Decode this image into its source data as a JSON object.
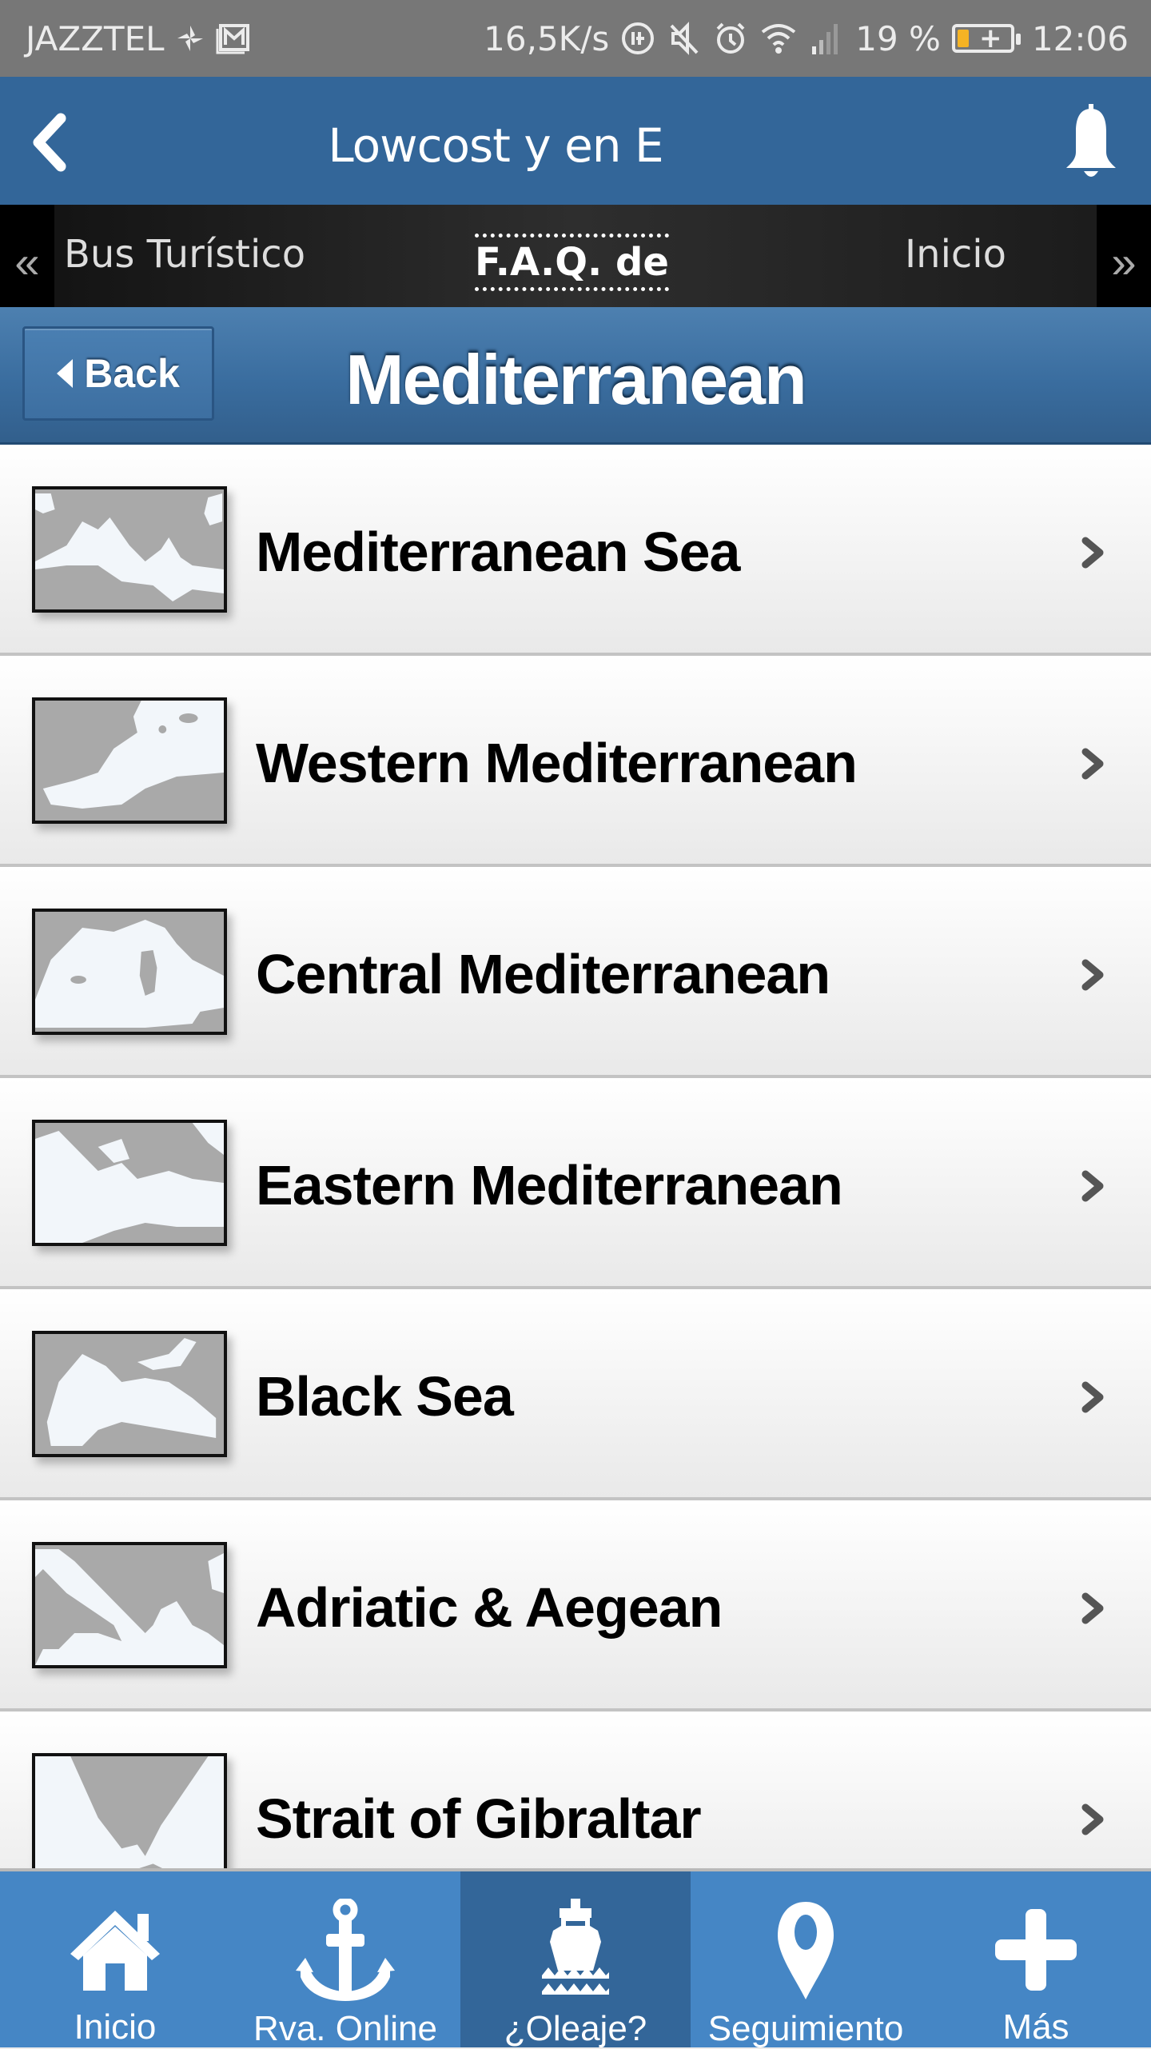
{
  "status_bar": {
    "carrier": "JAZZTEL",
    "net_speed": "16,5K/s",
    "battery_percent": "19 %",
    "battery_level": 0.19,
    "battery_color": "#f5b324",
    "time": "12:06",
    "icons": [
      "sync-icon",
      "gmail-icon",
      "data-saver-icon",
      "mute-icon",
      "alarm-icon",
      "wifi-icon",
      "signal-icon",
      "battery-charging-icon"
    ]
  },
  "header": {
    "title": "Lowcost y en E",
    "back_icon": "chevron-left-icon",
    "bell_icon": "bell-icon",
    "bg_color": "#336699"
  },
  "tabs": {
    "prev_icon": "double-chevron-left-icon",
    "next_icon": "double-chevron-right-icon",
    "items": [
      {
        "label": "Bus Turístico",
        "active": false
      },
      {
        "label": "F.A.Q. de",
        "active": true
      },
      {
        "label": "Inicio",
        "active": false
      }
    ]
  },
  "sub_header": {
    "back_label": "Back",
    "title": "Mediterranean"
  },
  "list": {
    "items": [
      {
        "label": "Mediterranean Sea",
        "thumb": "map-mediterranean-sea"
      },
      {
        "label": "Western Mediterranean",
        "thumb": "map-western-mediterranean"
      },
      {
        "label": "Central Mediterranean",
        "thumb": "map-central-mediterranean"
      },
      {
        "label": "Eastern Mediterranean",
        "thumb": "map-eastern-mediterranean"
      },
      {
        "label": "Black Sea",
        "thumb": "map-black-sea"
      },
      {
        "label": "Adriatic & Aegean",
        "thumb": "map-adriatic-aegean"
      },
      {
        "label": "Strait of Gibraltar",
        "thumb": "map-strait-of-gibraltar"
      }
    ]
  },
  "bottom_nav": {
    "active_color": "#336699",
    "bg_color": "#4586c5",
    "items": [
      {
        "label": "Inicio",
        "icon": "home-icon",
        "active": false
      },
      {
        "label": "Rva. Online",
        "icon": "anchor-icon",
        "active": false
      },
      {
        "label": "¿Oleaje?",
        "icon": "ship-waves-icon",
        "active": true
      },
      {
        "label": "Seguimiento",
        "icon": "map-pin-icon",
        "active": false
      },
      {
        "label": "Más",
        "icon": "plus-icon",
        "active": false
      }
    ]
  }
}
